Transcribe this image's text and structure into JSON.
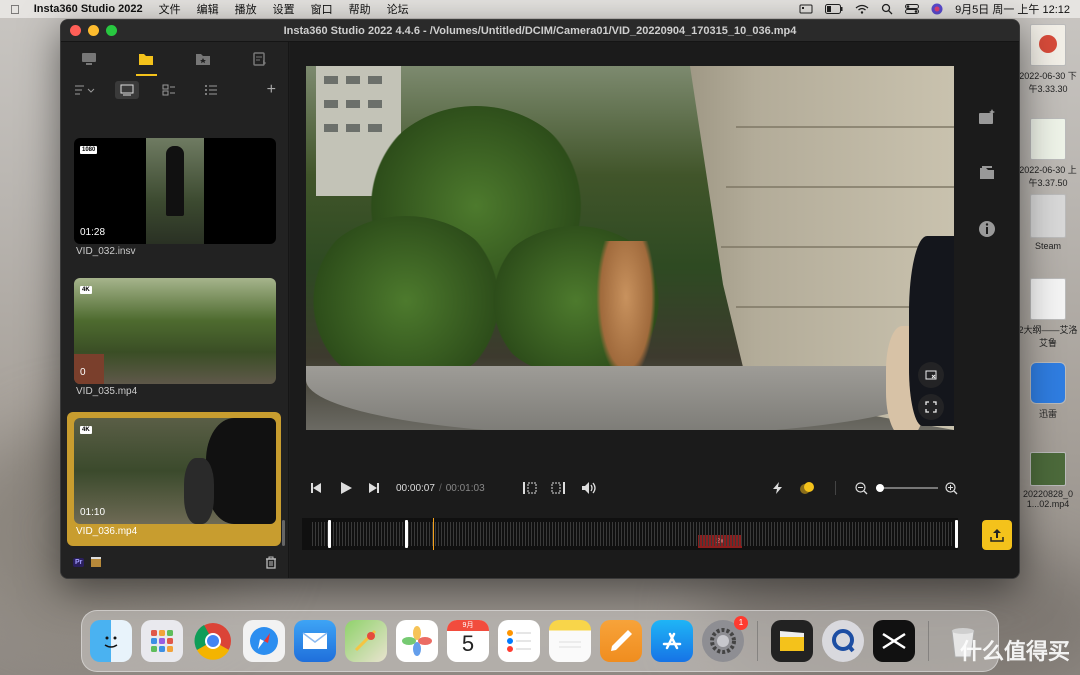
{
  "menubar": {
    "app_name": "Insta360 Studio 2022",
    "items": [
      "文件",
      "编辑",
      "播放",
      "设置",
      "窗口",
      "帮助",
      "论坛"
    ],
    "clock": "9月5日 周一 上午 12:12"
  },
  "window": {
    "title": "Insta360 Studio 2022 4.4.6 - /Volumes/Untitled/DCIM/Camera01/VID_20220904_170315_10_036.mp4"
  },
  "sidebar": {
    "tabs": [
      "screen-icon",
      "folder-icon",
      "favorites-icon",
      "export-list-icon"
    ],
    "active_tab": 1,
    "clips": [
      {
        "name": "VID_032.insv",
        "duration": "01:28",
        "badge": "1080",
        "selected": false
      },
      {
        "name": "VID_035.mp4",
        "duration": "0",
        "badge": "4K",
        "selected": false
      },
      {
        "name": "VID_036.mp4",
        "duration": "01:10",
        "badge": "4K",
        "selected": true
      }
    ],
    "pr_label": "Pr"
  },
  "player": {
    "current_time": "00:00:07",
    "separator": "/",
    "total_time": "00:01:03",
    "zoom_level": 0
  },
  "timeline": {
    "speed_tag": "2x",
    "trim_start": 0.04,
    "trim_end": 0.995,
    "playhead": 0.2
  },
  "desktop": {
    "icons": [
      {
        "label": "2022-06-30 下午3.33.30"
      },
      {
        "label": "2022-06-30 上午3.37.50"
      },
      {
        "label": "Steam"
      },
      {
        "label": "2大纲——艾洛艾鲁"
      },
      {
        "label": "迅雷"
      },
      {
        "label": "20220828_0 1...02.mp4"
      }
    ]
  },
  "dock": {
    "apps": [
      "Finder",
      "Launchpad",
      "Chrome",
      "Safari",
      "Mail",
      "Maps",
      "Photos",
      "Calendar",
      "Reminders",
      "Notes",
      "Pages",
      "App Store",
      "System Preferences",
      "Final Cut",
      "QuickTime",
      "CapCut",
      "Trash"
    ],
    "calendar_month": "9月",
    "calendar_day": "5",
    "settings_badge": "1"
  },
  "watermark": "什么值得买"
}
